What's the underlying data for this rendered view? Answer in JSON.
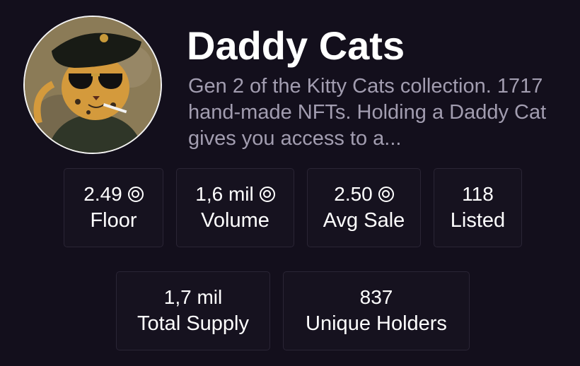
{
  "collection": {
    "name": "Daddy Cats",
    "description": "Gen 2 of the Kitty Cats collection. 1717 hand-made NFTs. Holding a Daddy Cat gives you access to a..."
  },
  "stats": [
    {
      "value": "2.49",
      "label": "Floor",
      "currency_icon": "sol-coin-icon"
    },
    {
      "value": "1,6 mil",
      "label": "Volume",
      "currency_icon": "sol-coin-icon"
    },
    {
      "value": "2.50",
      "label": "Avg Sale",
      "currency_icon": "sol-coin-icon"
    },
    {
      "value": "118",
      "label": "Listed"
    }
  ],
  "stats2": [
    {
      "value": "1,7 mil",
      "label": "Total Supply"
    },
    {
      "value": "837",
      "label": "Unique Holders"
    }
  ]
}
